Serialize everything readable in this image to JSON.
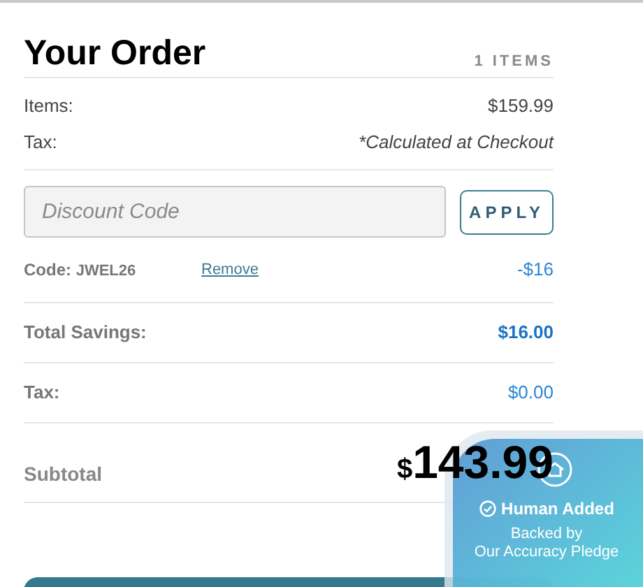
{
  "title": "Your Order",
  "item_count": "1 ITEMS",
  "summary": [
    {
      "label": "Items:",
      "value": "$159.99",
      "kind": "plain"
    },
    {
      "label": "Tax:",
      "value": "*Calculated at Checkout",
      "kind": "note"
    }
  ],
  "discount": {
    "placeholder": "Discount Code",
    "button": "APPLY"
  },
  "applied_code": {
    "label": "Code:",
    "code": "JWEL26",
    "remove": "Remove",
    "amount": "-$16"
  },
  "totals": [
    {
      "label": "Total Savings:",
      "value": "$16.00",
      "kind": "savings"
    },
    {
      "label": "Tax:",
      "value": "$0.00",
      "kind": "tax"
    }
  ],
  "subtotal": {
    "label": "Subtotal",
    "currency": "$",
    "amount": "143.99"
  },
  "badge": {
    "title": "Human Added",
    "line_1": "Backed by",
    "line_2": "Our Accuracy Pledge"
  }
}
